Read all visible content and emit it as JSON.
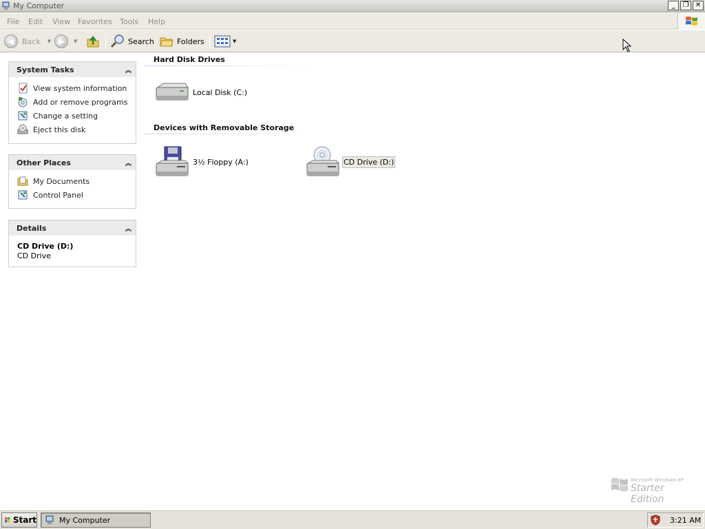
{
  "window": {
    "title": "My Computer",
    "minimize": "_",
    "restore": "❐",
    "close": "✕"
  },
  "menu": {
    "items": [
      "File",
      "Edit",
      "View",
      "Favorites",
      "Tools",
      "Help"
    ]
  },
  "toolbar": {
    "back": "Back",
    "search": "Search",
    "folders": "Folders"
  },
  "sidebar": {
    "system_tasks": {
      "title": "System Tasks",
      "items": [
        "View system information",
        "Add or remove programs",
        "Change a setting",
        "Eject this disk"
      ]
    },
    "other_places": {
      "title": "Other Places",
      "items": [
        "My Documents",
        "Control Panel"
      ]
    },
    "details": {
      "title": "Details",
      "name": "CD Drive (D:)",
      "type": "CD Drive"
    }
  },
  "content": {
    "groups": [
      {
        "title": "Hard Disk Drives",
        "items": [
          {
            "label": "Local Disk (C:)",
            "icon": "hard-disk-icon"
          }
        ]
      },
      {
        "title": "Devices with Removable Storage",
        "items": [
          {
            "label": "3½ Floppy (A:)",
            "icon": "floppy-drive-icon"
          },
          {
            "label": "CD Drive (D:)",
            "icon": "cd-drive-icon",
            "selected": true
          }
        ]
      }
    ]
  },
  "watermark": {
    "small": "Microsoft Windows XP",
    "big": "Starter Edition"
  },
  "taskbar": {
    "start": "Start",
    "window_button": "My Computer",
    "clock": "3:21 AM"
  },
  "colors": {
    "accent_selection": "#eceae2",
    "panel_header": "#ebebeb",
    "taskbar": "#e4e2da"
  }
}
